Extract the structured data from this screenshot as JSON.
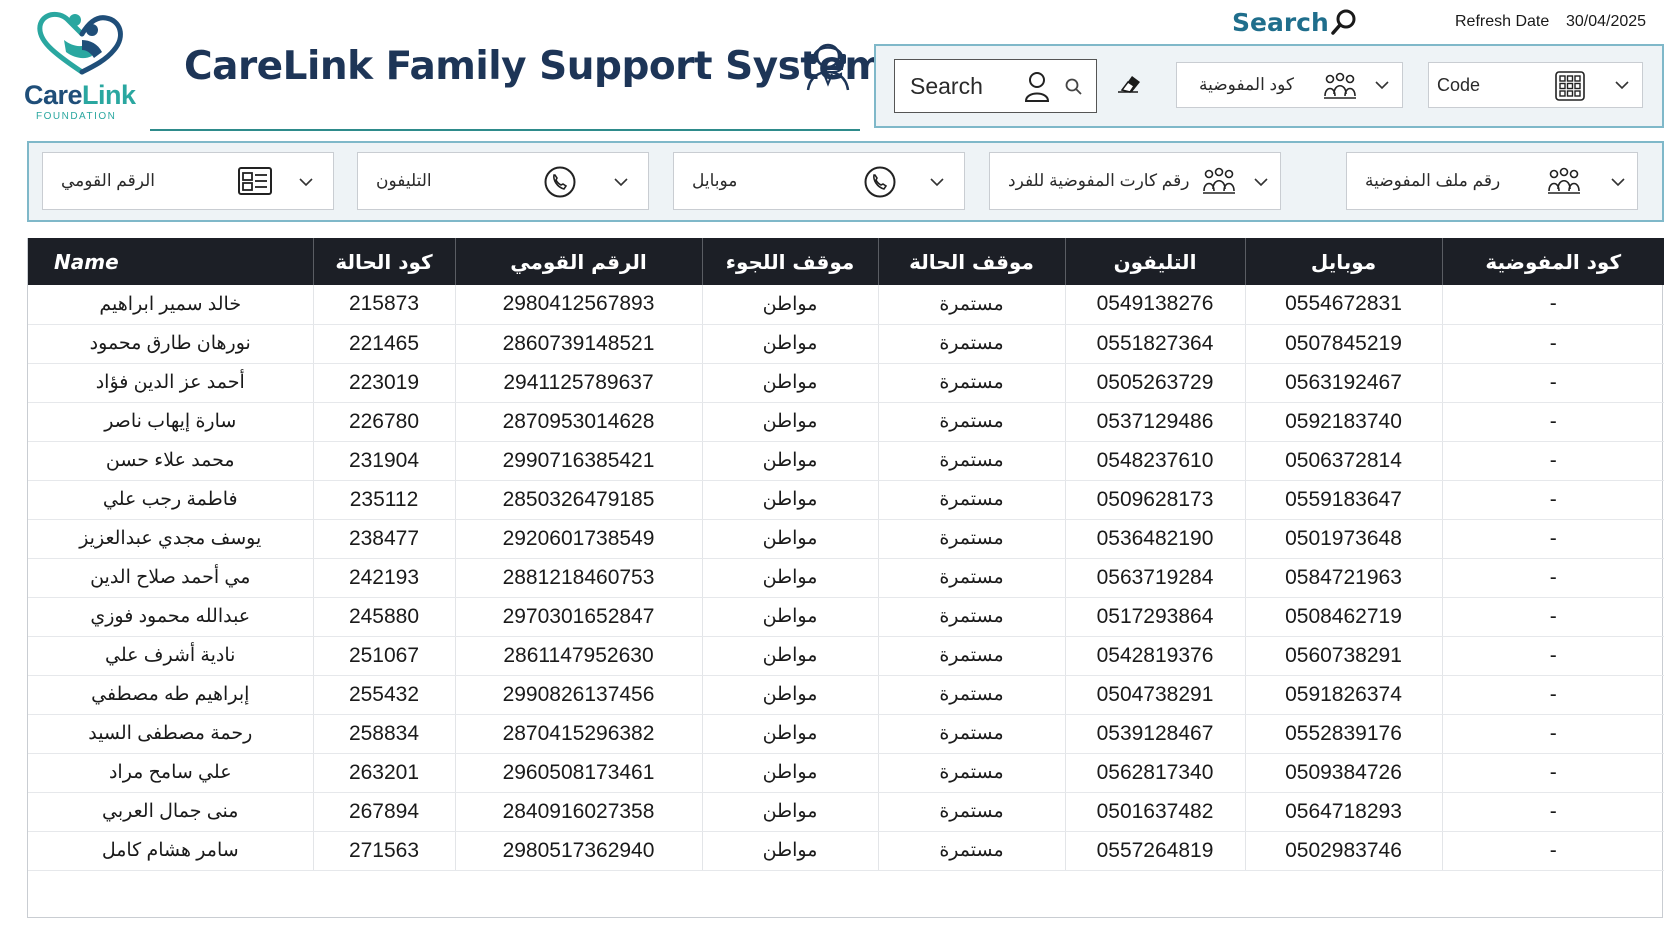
{
  "header": {
    "logo_word_part1": "Care",
    "logo_word_part2": "Link",
    "logo_subtitle": "FOUNDATION",
    "app_title": "CareLink Family Support System",
    "search_heading": "Search",
    "refresh_label": "Refresh Date",
    "refresh_date": "30/04/2025"
  },
  "colors": {
    "brand_navy": "#1d3557",
    "brand_teal": "#2aa7a0",
    "panel_border": "#7fb8c9",
    "table_header_bg": "#1c1f26"
  },
  "top_filters": {
    "search_label": "Search",
    "search_icons": [
      "person-icon",
      "magnifier-icon"
    ],
    "eraser_icon": "eraser-icon",
    "commission_code_label": "كود المفوضية",
    "code_label": "Code"
  },
  "filters": [
    {
      "label": "الرقم القومي",
      "icon": "id-card-icon"
    },
    {
      "label": "التليفون",
      "icon": "phone-icon"
    },
    {
      "label": "موبايل",
      "icon": "phone-icon"
    },
    {
      "label": "رقم كارت المفوضية للفرد",
      "icon": "family-icon"
    },
    {
      "label": "رقم ملف المفوضية",
      "icon": "family-icon"
    }
  ],
  "table": {
    "columns": [
      "Name",
      "كود الحالة",
      "الرقم القومي",
      "موقف اللجوء",
      "موقف الحالة",
      "التليفون",
      "موبايل",
      "كود المفوضية"
    ],
    "rows": [
      [
        "خالد سمير ابراهيم",
        "215873",
        "2980412567893",
        "مواطن",
        "مستمرة",
        "0549138276",
        "0554672831",
        "-"
      ],
      [
        "نورهان طارق محمود",
        "221465",
        "2860739148521",
        "مواطن",
        "مستمرة",
        "0551827364",
        "0507845219",
        "-"
      ],
      [
        "أحمد عز الدين فؤاد",
        "223019",
        "2941125789637",
        "مواطن",
        "مستمرة",
        "0505263729",
        "0563192467",
        "-"
      ],
      [
        "سارة إيهاب ناصر",
        "226780",
        "2870953014628",
        "مواطن",
        "مستمرة",
        "0537129486",
        "0592183740",
        "-"
      ],
      [
        "محمد علاء حسن",
        "231904",
        "2990716385421",
        "مواطن",
        "مستمرة",
        "0548237610",
        "0506372814",
        "-"
      ],
      [
        "فاطمة رجب علي",
        "235112",
        "2850326479185",
        "مواطن",
        "مستمرة",
        "0509628173",
        "0559183647",
        "-"
      ],
      [
        "يوسف مجدي عبدالعزيز",
        "238477",
        "2920601738549",
        "مواطن",
        "مستمرة",
        "0536482190",
        "0501973648",
        "-"
      ],
      [
        "مي أحمد صلاح الدين",
        "242193",
        "2881218460753",
        "مواطن",
        "مستمرة",
        "0563719284",
        "0584721963",
        "-"
      ],
      [
        "عبدالله محمود فوزي",
        "245880",
        "2970301652847",
        "مواطن",
        "مستمرة",
        "0517293864",
        "0508462719",
        "-"
      ],
      [
        "نادية أشرف علي",
        "251067",
        "2861147952630",
        "مواطن",
        "مستمرة",
        "0542819376",
        "0560738291",
        "-"
      ],
      [
        "إبراهيم طه مصطفي",
        "255432",
        "2990826137456",
        "مواطن",
        "مستمرة",
        "0504738291",
        "0591826374",
        "-"
      ],
      [
        "رحمة مصطفى السيد",
        "258834",
        "2870415296382",
        "مواطن",
        "مستمرة",
        "0539128467",
        "0552839176",
        "-"
      ],
      [
        "علي سامح مراد",
        "263201",
        "2960508173461",
        "مواطن",
        "مستمرة",
        "0562817340",
        "0509384726",
        "-"
      ],
      [
        "منى جمال العربي",
        "267894",
        "2840916027358",
        "مواطن",
        "مستمرة",
        "0501637482",
        "0564718293",
        "-"
      ],
      [
        "سامر هشام كامل",
        "271563",
        "2980517362940",
        "مواطن",
        "مستمرة",
        "0557264819",
        "0502983746",
        "-"
      ]
    ]
  }
}
